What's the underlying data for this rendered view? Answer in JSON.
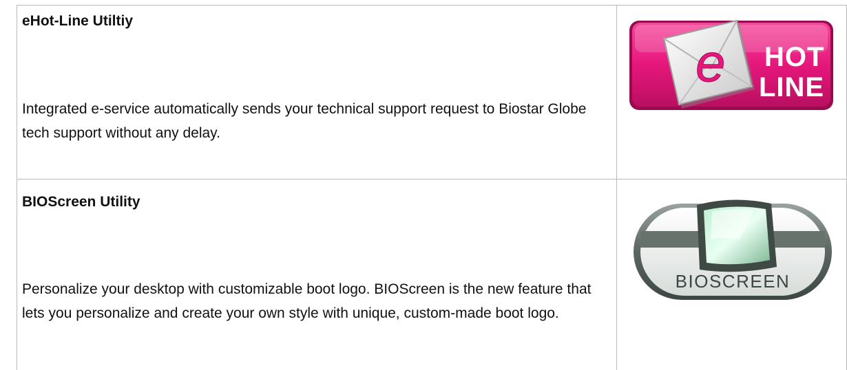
{
  "features": [
    {
      "title": "eHot-Line Utiltiy",
      "description": "Integrated e-service automatically sends your technical support request to Biostar Globe tech support without any delay.",
      "logo": {
        "icon": "envelope-e-icon",
        "letter": "e",
        "line1": "HOT",
        "line2": "LINE",
        "color": "#e6177c"
      }
    },
    {
      "title": "BIOScreen Utility",
      "description": "Personalize your desktop with customizable boot logo. BIOScreen is the new feature that lets you personalize and create your own style with unique, custom-made boot logo.",
      "logo": {
        "icon": "monitor-icon",
        "text": "BIOSCREEN",
        "color": "#6e7a74"
      }
    }
  ]
}
